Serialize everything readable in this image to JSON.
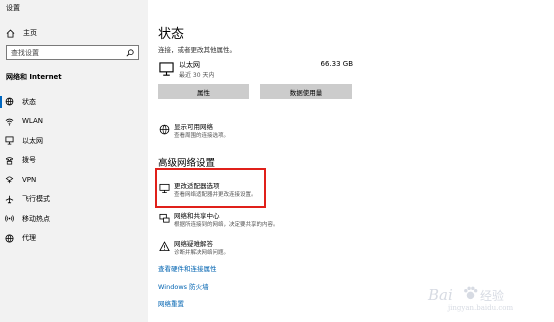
{
  "window": {
    "title": "设置"
  },
  "sidebar": {
    "home_label": "主页",
    "search_placeholder": "查找设置",
    "section_header": "网络和 Internet",
    "items": [
      {
        "label": "状态",
        "icon": "home-globe-icon",
        "active": true
      },
      {
        "label": "WLAN",
        "icon": "wifi-icon",
        "active": false
      },
      {
        "label": "以太网",
        "icon": "ethernet-icon",
        "active": false
      },
      {
        "label": "拨号",
        "icon": "dialup-icon",
        "active": false
      },
      {
        "label": "VPN",
        "icon": "vpn-icon",
        "active": false
      },
      {
        "label": "飞行模式",
        "icon": "airplane-icon",
        "active": false
      },
      {
        "label": "移动热点",
        "icon": "hotspot-icon",
        "active": false
      },
      {
        "label": "代理",
        "icon": "globe-icon",
        "active": false
      }
    ]
  },
  "main": {
    "title": "状态",
    "subtitle": "连接，或者更改其他属性。",
    "connection": {
      "name": "以太网",
      "time": "最近 30 天内",
      "data_size": "66.33 GB"
    },
    "buttons": {
      "properties": "属性",
      "data_usage": "数据使用量"
    },
    "show_networks": {
      "title": "显示可用网络",
      "desc": "查看周围的连接选项。"
    },
    "advanced_title": "高级网络设置",
    "advanced_items": [
      {
        "title": "更改适配器选项",
        "desc": "查看网络适配器并更改连接设置。"
      },
      {
        "title": "网络和共享中心",
        "desc": "根据所连接到的网络，决定要共享的内容。"
      },
      {
        "title": "网络疑难解答",
        "desc": "诊断并解决网络问题。"
      }
    ],
    "links": [
      "查看硬件和连接属性",
      "Windows 防火墙",
      "网络重置"
    ]
  },
  "colors": {
    "accent": "#0067c0",
    "link": "#0063b1",
    "highlight": "#e0201a",
    "sidebar_bg": "#f2f2f2",
    "button_bg": "#cccccc"
  },
  "watermark": {
    "brand_left": "Bai",
    "brand_right": "经验",
    "url": "jingyan.baidu.com"
  }
}
